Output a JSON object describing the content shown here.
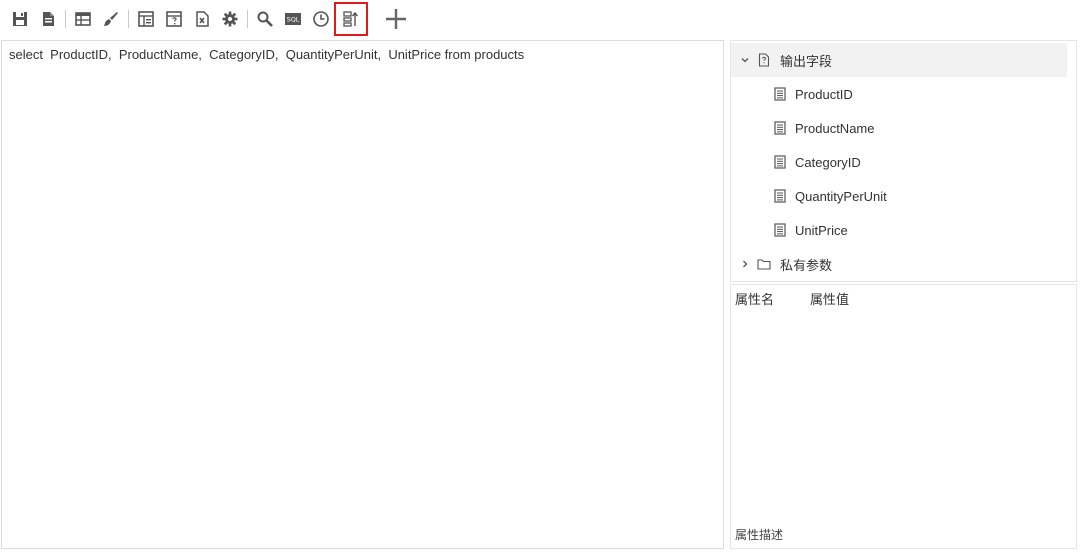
{
  "editor": {
    "sql": "select  ProductID,  ProductName,  CategoryID,  QuantityPerUnit,  UnitPrice from products"
  },
  "tree": {
    "output_fields": {
      "label": "输出字段",
      "items": [
        "ProductID",
        "ProductName",
        "CategoryID",
        "QuantityPerUnit",
        "UnitPrice"
      ]
    },
    "private_params": {
      "label": "私有参数"
    }
  },
  "properties": {
    "col_name": "属性名",
    "col_value": "属性值",
    "description_label": "属性描述"
  },
  "icons": {
    "toolbar": [
      "save-icon",
      "save-as-icon",
      "table-icon",
      "clear-brush-icon",
      "layout-icon",
      "param-table-icon",
      "excel-import-icon",
      "settings-gear-icon",
      "search-icon",
      "sql-icon",
      "history-clock-icon",
      "field-sort-icon",
      "add-icon"
    ]
  },
  "colors": {
    "highlight": "#e0191e",
    "icon": "#555555",
    "selected_row": "#f2f2f2"
  }
}
